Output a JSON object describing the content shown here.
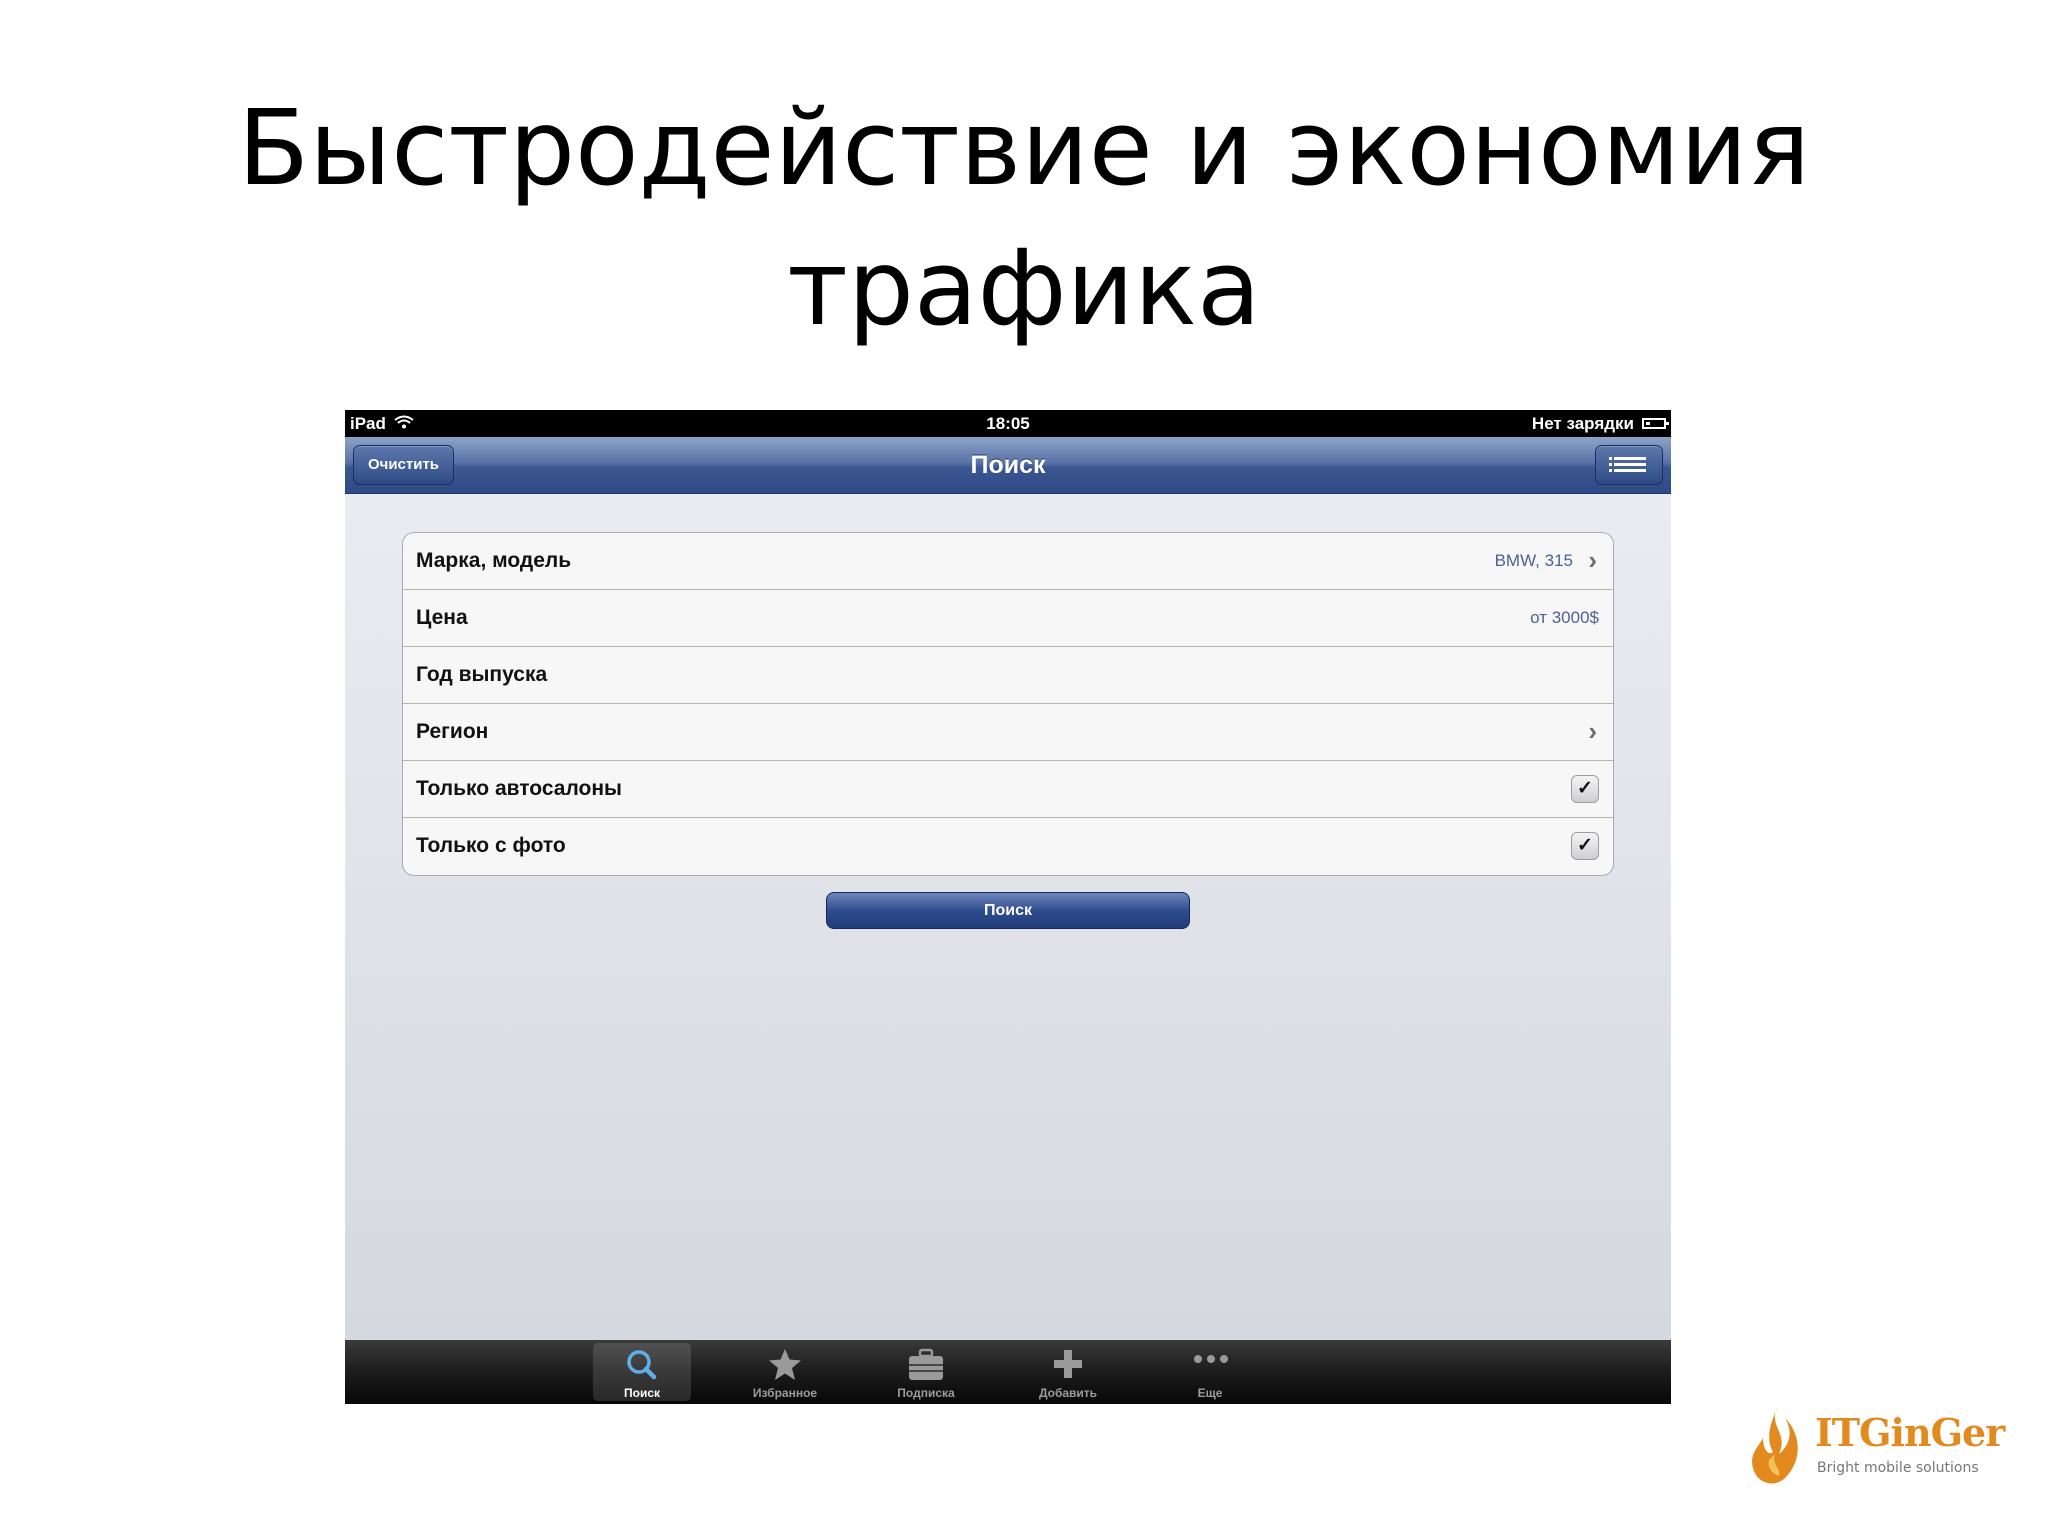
{
  "slide": {
    "title_line1": "Быстродействие и экономия",
    "title_line2": "трафика"
  },
  "status_bar": {
    "device": "iPad",
    "time": "18:05",
    "battery_text": "Нет зарядки"
  },
  "nav": {
    "title": "Поиск",
    "clear_label": "Очистить"
  },
  "form": {
    "rows": [
      {
        "label": "Марка, модель",
        "value": "BMW, 315"
      },
      {
        "label": "Цена",
        "value": "от 3000$"
      },
      {
        "label": "Год выпуска",
        "value": ""
      },
      {
        "label": "Регион",
        "value": ""
      },
      {
        "label": "Только автосалоны",
        "checked": true
      },
      {
        "label": "Только с фото",
        "checked": true
      }
    ],
    "search_button": "Поиск"
  },
  "tabs": [
    {
      "label": "Поиск",
      "icon": "search-icon",
      "active": true
    },
    {
      "label": "Избранное",
      "icon": "star-icon",
      "active": false
    },
    {
      "label": "Подписка",
      "icon": "briefcase-icon",
      "active": false
    },
    {
      "label": "Добавить",
      "icon": "plus-icon",
      "active": false
    },
    {
      "label": "Еще",
      "icon": "more-icon",
      "active": false
    }
  ],
  "logo": {
    "name": "ITGinGer",
    "tagline": "Bright mobile solutions",
    "color": "#e38a1f"
  }
}
